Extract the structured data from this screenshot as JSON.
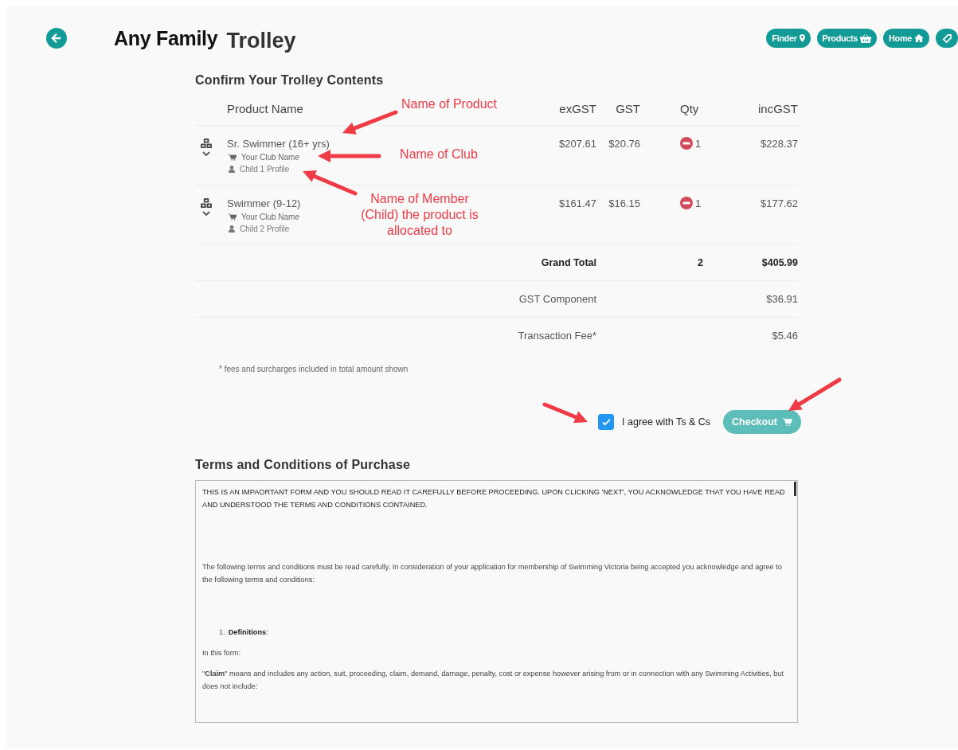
{
  "header": {
    "title": "Any Family",
    "subtitle": "Trolley",
    "nav": [
      "Finder",
      "Products",
      "Home"
    ]
  },
  "trolley": {
    "heading": "Confirm Your Trolley Contents",
    "columns": [
      "Product Name",
      "exGST",
      "GST",
      "Qty",
      "incGST"
    ],
    "items": [
      {
        "name": "Sr. Swimmer (16+ yrs)",
        "club": "Your Club Name",
        "member": "Child 1 Profile",
        "ex_gst": "$207.61",
        "gst": "$20.76",
        "qty": "1",
        "inc_gst": "$228.37"
      },
      {
        "name": "Swimmer (9-12)",
        "club": "Your Club Name",
        "member": "Child 2 Profile",
        "ex_gst": "$161.47",
        "gst": "$16.15",
        "qty": "1",
        "inc_gst": "$177.62"
      }
    ],
    "totals": [
      {
        "kind": "grand",
        "label": "Grand Total",
        "qty": "2",
        "value": "$405.99"
      },
      {
        "kind": "plain",
        "label": "GST Component",
        "value": "$36.91"
      },
      {
        "kind": "plain",
        "label": "Transaction Fee*",
        "value": "$5.46"
      }
    ],
    "footnote": "* fees and surcharges included in total amount shown"
  },
  "agree": {
    "label": "I agree with Ts & Cs",
    "checked": true
  },
  "checkout": {
    "label": "Checkout"
  },
  "terms": {
    "heading": "Terms and Conditions of Purchase",
    "paragraphs": [
      {
        "kind": "caps",
        "text": "THIS IS AN IMPAORTANT FORM AND YOU SHOULD READ IT CAREFULLY BEFORE PROCEEDING.  UPON CLICKING 'NEXT', YOU ACKNOWLEDGE THAT YOU HAVE READ AND UNDERSTOOD THE TERMS AND CONDITIONS CONTAINED."
      },
      {
        "kind": "para",
        "text": "The following terms and conditions must be read carefully.  In consideration of your application for membership of Swimming Victoria being accepted you acknowledge and agree to the following terms and conditions:"
      },
      {
        "kind": "list",
        "number": "1.",
        "text": "**Definitions**:"
      },
      {
        "kind": "para",
        "text": "In this form:"
      },
      {
        "kind": "para",
        "text": "\"**Claim**\" means and includes any action, suit, proceeding, claim, demand, damage, penalty, cost or expense however arising from or in connection with any Swimming Activities, but does not include:"
      }
    ]
  },
  "annotations": [
    "Name of Product",
    "Name of Club",
    "Name of Member (Child) the product is allocated to"
  ]
}
